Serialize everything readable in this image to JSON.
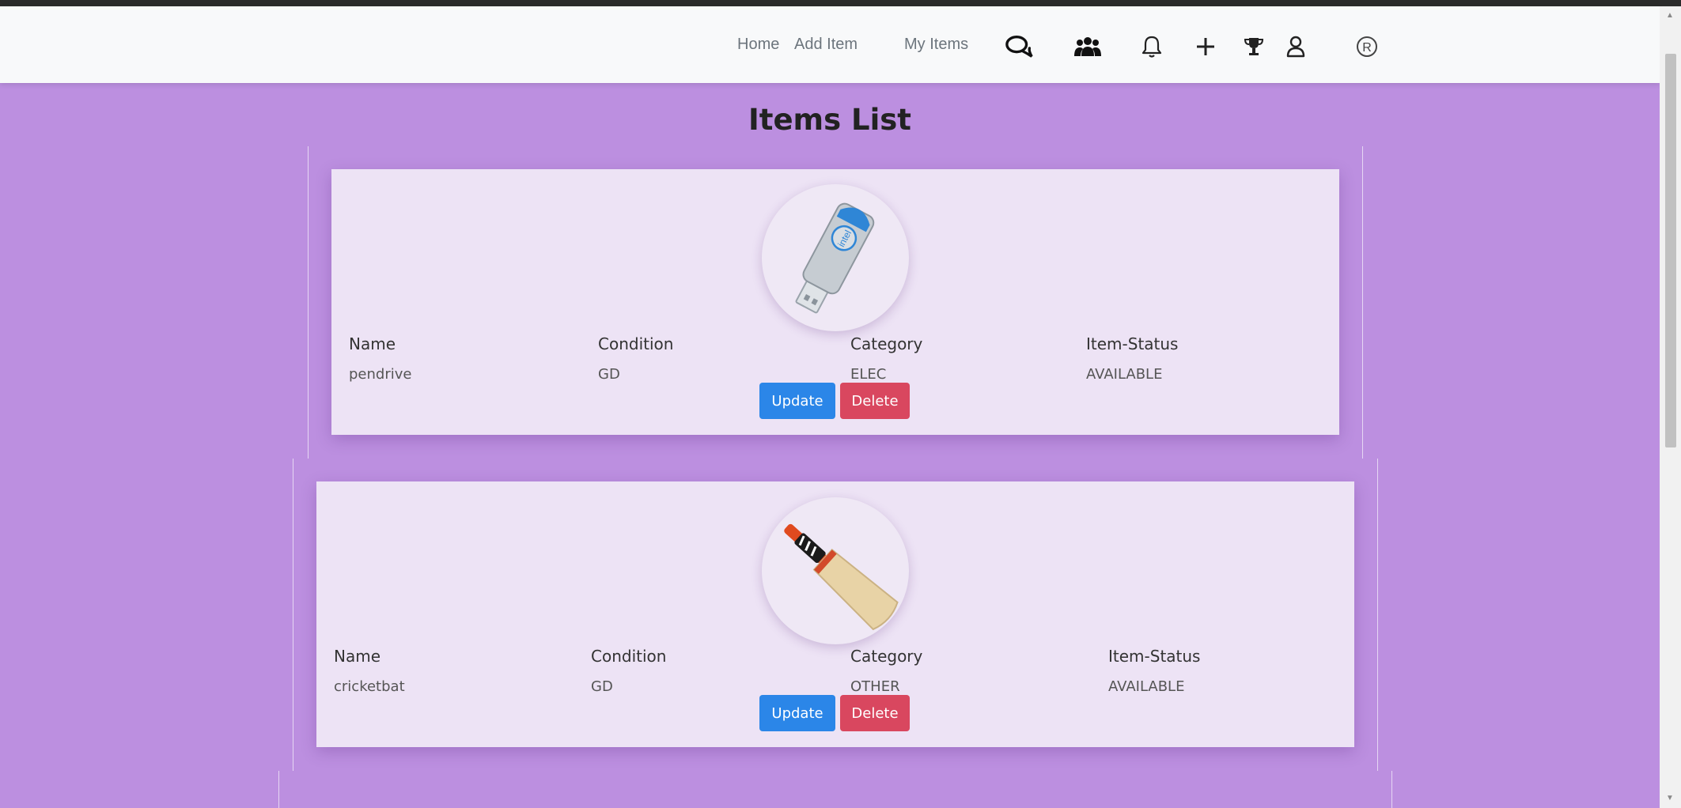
{
  "nav": {
    "links": [
      "Home",
      "Add Item",
      "My Items"
    ],
    "icons": [
      "chat-icon",
      "users-icon",
      "bell-icon",
      "plus-icon",
      "trophy-icon",
      "user-icon",
      "registered-icon"
    ]
  },
  "page": {
    "title": "Items List"
  },
  "labels": {
    "name": "Name",
    "condition": "Condition",
    "category": "Category",
    "status": "Item-Status",
    "update": "Update",
    "delete": "Delete"
  },
  "items": [
    {
      "name": "pendrive",
      "condition": "GD",
      "category": "ELEC",
      "status": "AVAILABLE"
    },
    {
      "name": "cricketbat",
      "condition": "GD",
      "category": "OTHER",
      "status": "AVAILABLE"
    }
  ],
  "colors": {
    "background": "#bc8fe0",
    "card": "#ede3f5",
    "update": "#2b86e8",
    "delete": "#d9475f"
  }
}
